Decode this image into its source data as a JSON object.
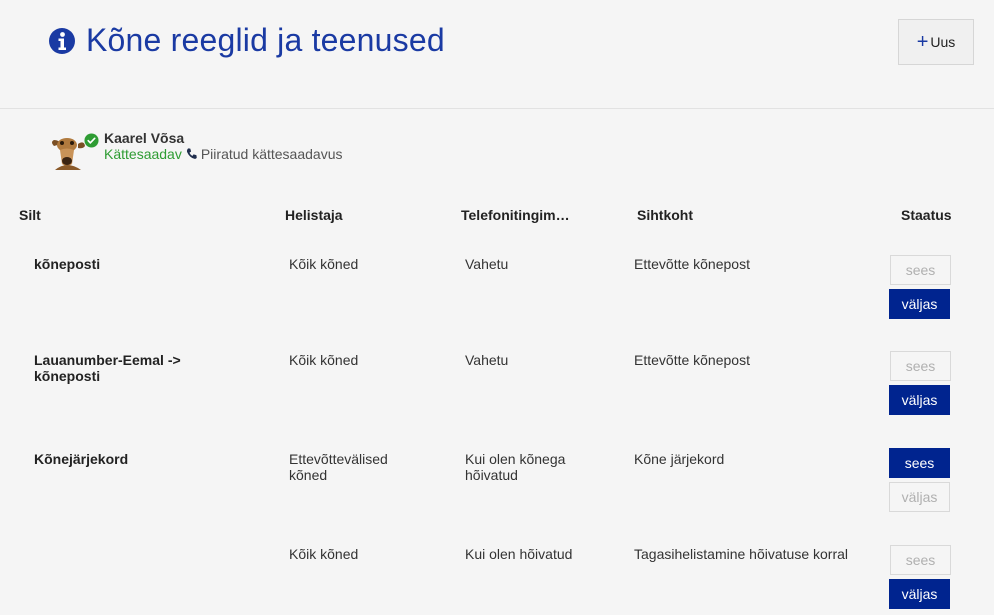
{
  "header": {
    "title": "Kõne reeglid ja teenused",
    "new_button_label": "Uus",
    "new_button_plus": "+"
  },
  "user": {
    "name": "Kaarel Võsa",
    "availability": "Kättesaadav",
    "limited": "Piiratud kättesaadavus"
  },
  "table": {
    "headers": [
      "Silt",
      "Helistaja",
      "Telefonitingim…",
      "Sihtkoht",
      "Staatus"
    ],
    "rows": [
      {
        "label": "kõneposti",
        "caller": "Kõik kõned",
        "condition": "Vahetu",
        "destination": "Ettevõtte kõnepost",
        "on": "sees",
        "off": "väljas",
        "active": "off"
      },
      {
        "label": "Lauanumber-Eemal -> kõneposti",
        "caller": "Kõik kõned",
        "condition": "Vahetu",
        "destination": "Ettevõtte kõnepost",
        "on": "sees",
        "off": "väljas",
        "active": "off"
      },
      {
        "label": "Kõnejärjekord",
        "caller": "Ettevõttevälised kõned",
        "condition": "Kui olen kõnega hõivatud",
        "destination": "Kõne järjekord",
        "on": "sees",
        "off": "väljas",
        "active": "on"
      },
      {
        "label": "",
        "caller": "Kõik kõned",
        "condition": "Kui olen hõivatud",
        "destination": "Tagasihelistamine hõivatuse korral",
        "on": "sees",
        "off": "väljas",
        "active": "off"
      }
    ]
  },
  "colors": {
    "accent": "#00248f",
    "title": "#1a3aa3",
    "available": "#2e9c33"
  },
  "icons": {
    "info": "info-icon",
    "check": "check-icon",
    "phone": "phone-icon",
    "plus": "plus-icon"
  }
}
